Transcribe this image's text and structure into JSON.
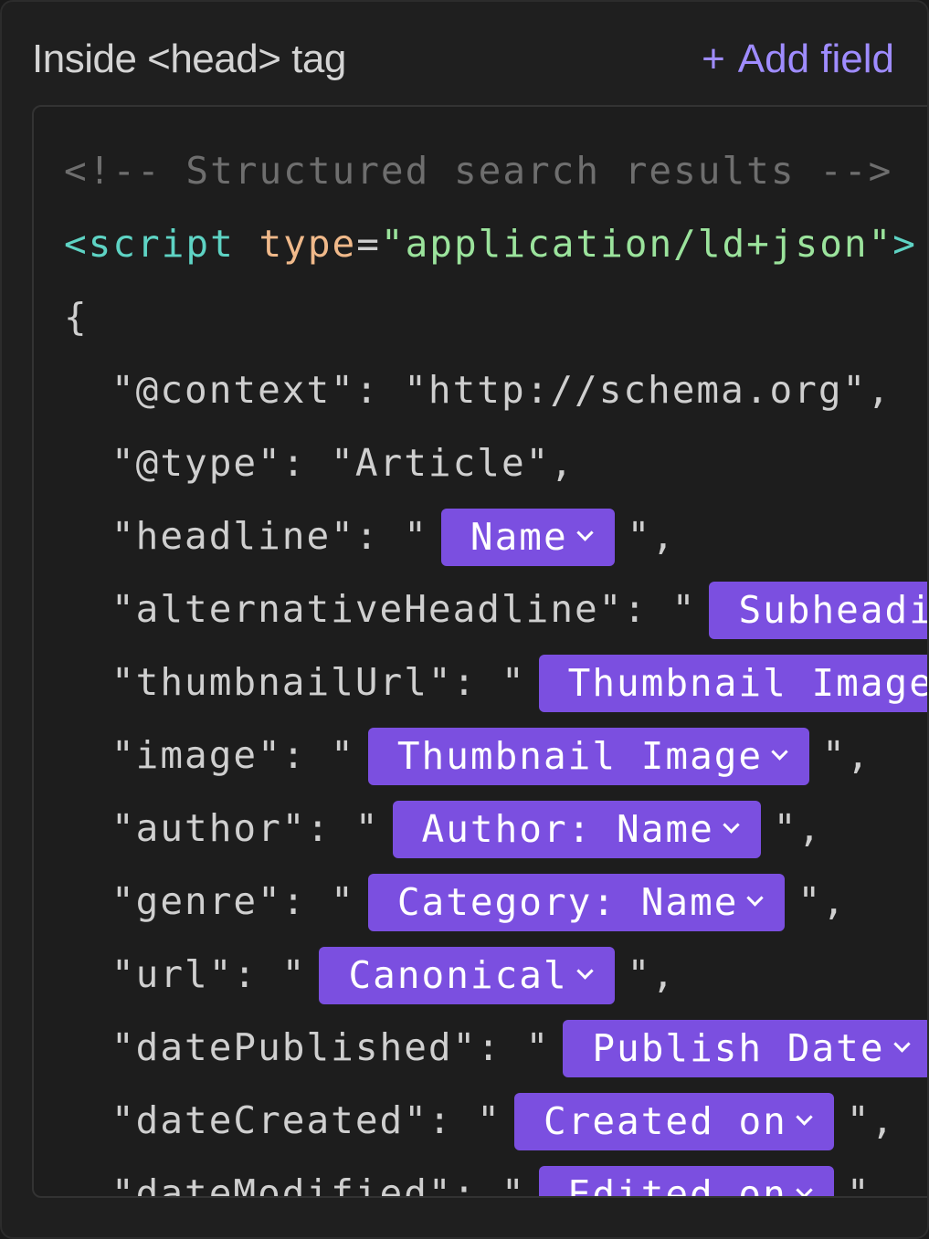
{
  "header": {
    "title": "Inside <head> tag",
    "add_icon": "+",
    "add_label": "Add field"
  },
  "code": {
    "comment": "<!-- Structured search results -->",
    "script_open": "<script",
    "type_attr": "type",
    "eq": "=",
    "type_value": "\"application/ld+json\"",
    "script_close": ">",
    "brace": "{",
    "fields": [
      {
        "key": "\"@context\"",
        "sep": ": ",
        "value": "\"http://schema.org\","
      },
      {
        "key": "\"@type\"",
        "sep": ": ",
        "value": "\"Article\","
      },
      {
        "key": "\"headline\"",
        "sep": ": \"",
        "chip": "Name",
        "tail": "\","
      },
      {
        "key": "\"alternativeHeadline\"",
        "sep": ": \"",
        "chip": "Subheading",
        "tail": "\","
      },
      {
        "key": "\"thumbnailUrl\"",
        "sep": ": \"",
        "chip": "Thumbnail Image",
        "tail": "\","
      },
      {
        "key": "\"image\"",
        "sep": ": \"",
        "chip": "Thumbnail Image",
        "tail": "\","
      },
      {
        "key": "\"author\"",
        "sep": ": \"",
        "chip": "Author: Name",
        "tail": "\","
      },
      {
        "key": "\"genre\"",
        "sep": ": \"",
        "chip": "Category: Name",
        "tail": "\","
      },
      {
        "key": "\"url\"",
        "sep": ": \"",
        "chip": "Canonical",
        "tail": "\","
      },
      {
        "key": "\"datePublished\"",
        "sep": ": \"",
        "chip": "Publish Date",
        "tail": "\","
      },
      {
        "key": "\"dateCreated\"",
        "sep": ": \"",
        "chip": "Created on",
        "tail": "\","
      },
      {
        "key": "\"dateModified\"",
        "sep": ": \"",
        "chip": "Edited on",
        "tail": "\","
      }
    ]
  },
  "colors": {
    "accent": "#9f8cff",
    "chip": "#7b4fe0",
    "tag": "#5ed3c4",
    "attr": "#f0b98a",
    "string": "#9be39c",
    "comment": "#6e6e6e"
  },
  "icons": {
    "chip_dropdown": "chevron-down-icon",
    "add": "plus-icon"
  }
}
